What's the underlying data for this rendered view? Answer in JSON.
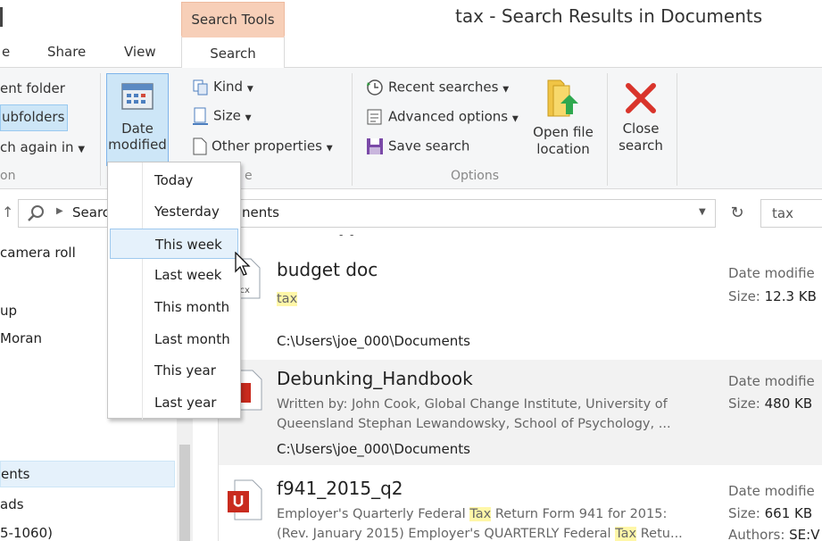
{
  "window": {
    "title": "tax - Search Results in Documents",
    "context_tab": "Search Tools"
  },
  "tabs": [
    {
      "label": "e"
    },
    {
      "label": "Share"
    },
    {
      "label": "View"
    },
    {
      "label": "Search",
      "active": true
    }
  ],
  "ribbon": {
    "location": {
      "current_folder": "ent folder",
      "subfolders": "ubfolders",
      "search_again": "ch again in",
      "group_label": "on"
    },
    "refine": {
      "date_modified_line1": "Date",
      "date_modified_line2": "modified",
      "kind": "Kind",
      "size": "Size",
      "other_properties": "Other properties",
      "group_label": "e"
    },
    "options": {
      "recent_searches": "Recent searches",
      "advanced_options": "Advanced options",
      "save_search": "Save search",
      "open_file_location_line1": "Open file",
      "open_file_location_line2": "location",
      "group_label": "Options"
    },
    "close": {
      "close_search_line1": "Close",
      "close_search_line2": "search"
    }
  },
  "address": {
    "crumb": "Searc",
    "crumb_tail": "nents",
    "search_query": "tax"
  },
  "date_menu": {
    "items": [
      "Today",
      "Yesterday",
      "This week",
      "Last week",
      "This month",
      "Last month",
      "This year",
      "Last year"
    ],
    "hovered": "This week"
  },
  "nav": {
    "items": [
      "camera roll",
      "up",
      "Moran",
      "ents",
      "ads",
      "5-1060)"
    ]
  },
  "results": [
    {
      "name": "budget doc",
      "snippet_hit": "tax",
      "path": "C:\\Users\\joe_000\\Documents",
      "meta_date_label": "Date modifie",
      "meta_size_label": "Size:",
      "meta_size": "12.3 KB",
      "icon": "docx-file-icon"
    },
    {
      "name": "Debunking_Handbook",
      "snippet_line1": "Written by: John Cook, Global Change Institute, University of",
      "snippet_line2": "Queensland Stephan Lewandowsky, School of Psychology, ...",
      "path": "C:\\Users\\joe_000\\Documents",
      "meta_date_label": "Date modifie",
      "meta_size_label": "Size:",
      "meta_size": "480 KB",
      "icon": "pdf-file-icon"
    },
    {
      "name": "f941_2015_q2",
      "snippet_line1_a": "Employer's Quarterly Federal ",
      "snippet_line1_hit": "Tax",
      "snippet_line1_b": " Return Form 941 for 2015:",
      "snippet_line2_a": "(Rev. January 2015) Employer's QUARTERLY Federal ",
      "snippet_line2_hit": "Tax",
      "snippet_line2_b": " Retu...",
      "meta_date_label": "Date modifie",
      "meta_size_label": "Size:",
      "meta_size": "661 KB",
      "meta_authors_label": "Authors:",
      "meta_authors": "SE:V",
      "icon": "pdf-file-icon"
    }
  ],
  "colors": {
    "context_tab": "#f7cfb8",
    "selection": "#cde6f7",
    "hit_highlight": "#fff7a8",
    "close_x": "#d9342b"
  }
}
